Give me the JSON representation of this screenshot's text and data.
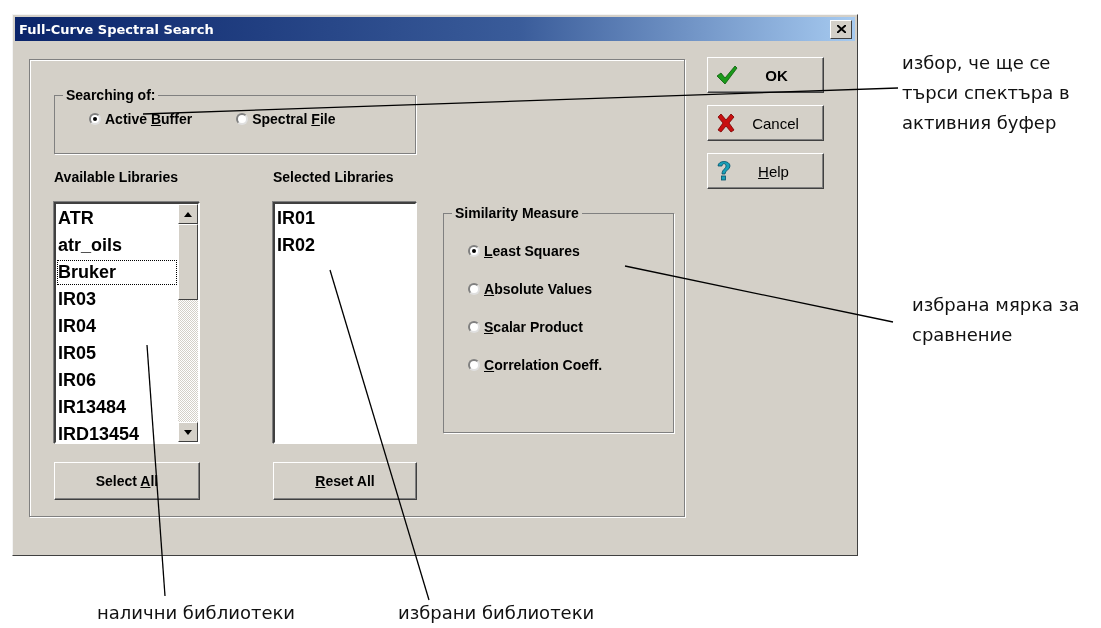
{
  "window": {
    "title": "Full-Curve Spectral Search"
  },
  "searching_of": {
    "legend": "Searching of:",
    "options": [
      {
        "label": {
          "pre": "Active ",
          "key": "B",
          "post": "uffer"
        },
        "selected": true
      },
      {
        "label": {
          "pre": "Spectral ",
          "key": "F",
          "post": "ile"
        },
        "selected": false
      }
    ]
  },
  "available_libraries": {
    "label": "Available Libraries",
    "items": [
      {
        "text": "ATR",
        "focused": false
      },
      {
        "text": "atr_oils",
        "focused": false
      },
      {
        "text": "Bruker",
        "focused": true
      },
      {
        "text": "IR03",
        "focused": false
      },
      {
        "text": "IR04",
        "focused": false
      },
      {
        "text": "IR05",
        "focused": false
      },
      {
        "text": "IR06",
        "focused": false
      },
      {
        "text": "IR13484",
        "focused": false
      },
      {
        "text": "IRD13454",
        "focused": false
      }
    ],
    "button": {
      "pre": "Select ",
      "key": "A",
      "post": "ll"
    }
  },
  "selected_libraries": {
    "label": "Selected Libraries",
    "items": [
      {
        "text": "IR01",
        "focused": false
      },
      {
        "text": "IR02",
        "focused": false
      }
    ],
    "button": {
      "key": "R",
      "post": "eset All"
    }
  },
  "similarity_measure": {
    "legend": "Similarity Measure",
    "options": [
      {
        "label": {
          "key": "L",
          "post": "east Squares"
        },
        "selected": true
      },
      {
        "label": {
          "key": "A",
          "post": "bsolute Values"
        },
        "selected": false
      },
      {
        "label": {
          "key": "S",
          "post": "calar Product"
        },
        "selected": false
      },
      {
        "label": {
          "key": "C",
          "post": "orrelation Coeff."
        },
        "selected": false
      }
    ]
  },
  "buttons": [
    {
      "kind": "ok",
      "label": {
        "pre": "OK"
      }
    },
    {
      "kind": "cancel",
      "label": {
        "pre": "Cancel"
      }
    },
    {
      "kind": "help",
      "label": {
        "key": "H",
        "post": "elp"
      }
    }
  ],
  "annotations": [
    {
      "kind": "search_source",
      "text": "избор, че ще се\nтърси спектъра в\nактивния буфер"
    },
    {
      "kind": "measure",
      "text": "избрана мярка за\nсравнение"
    },
    {
      "kind": "available",
      "text": "налични библиотеки"
    },
    {
      "kind": "selected",
      "text": "избрани библиотеки"
    }
  ]
}
